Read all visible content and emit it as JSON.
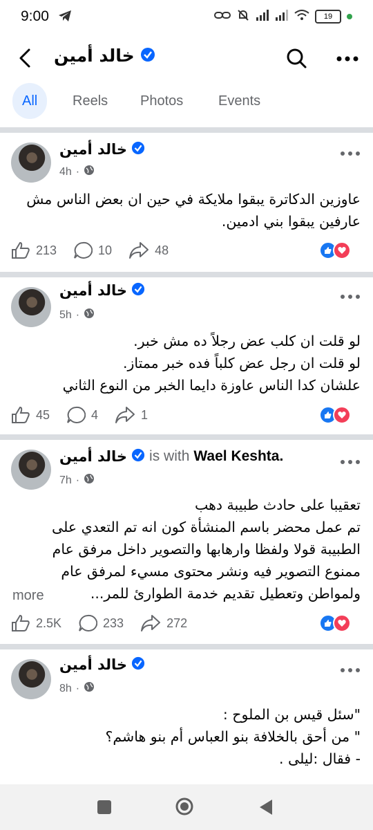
{
  "status_bar": {
    "time": "9:00",
    "battery": "19"
  },
  "header": {
    "title": "خالد أمين"
  },
  "tabs": [
    {
      "label": "All",
      "active": true
    },
    {
      "label": "Reels",
      "active": false
    },
    {
      "label": "Photos",
      "active": false
    },
    {
      "label": "Events",
      "active": false
    }
  ],
  "posts": [
    {
      "author": "خالد أمين",
      "time": "4h",
      "text": "عاوزين الدكاترة يبقوا ملايكة في حين ان بعض الناس مش عارفين يبقوا بني ادمين.",
      "likes": "213",
      "comments": "10",
      "shares": "48"
    },
    {
      "author": "خالد أمين",
      "time": "5h",
      "text": "لو قلت ان كلب عض رجلاً ده مش خبر.\nلو قلت ان رجل عض كلباً فده خبر ممتاز.\nعلشان كدا الناس عاوزة دايما الخبر من النوع الثاني",
      "likes": "45",
      "comments": "4",
      "shares": "1"
    },
    {
      "author": "خالد أمين",
      "with_label": "is with",
      "with_name": "Wael Keshta.",
      "time": "7h",
      "text": "تعقيبا على حادث طبيبة دهب\nتم عمل محضر باسم المنشأة كون انه تم التعدي على الطبيبة قولا ولفظا وارهابها والتصوير داخل مرفق عام ممنوع التصوير فيه ونشر محتوى مسيء لمرفق عام ولمواطن وتعطيل تقديم خدمة الطوارئ للمر...",
      "see_more": "more",
      "likes": "2.5K",
      "comments": "233",
      "shares": "272"
    },
    {
      "author": "خالد أمين",
      "time": "8h",
      "text": "\"سئل قيس بن الملوح :\n\" من أحق بالخلافة بنو العباس أم بنو هاشم؟\n- فقال :ليلى ."
    }
  ]
}
